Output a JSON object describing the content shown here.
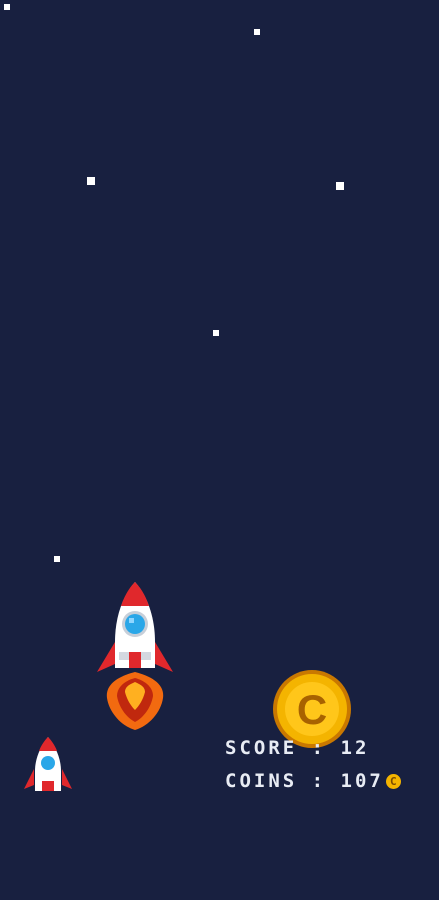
{
  "hud": {
    "score_label": "SCORE : 12",
    "coins_label": "COINS : 107",
    "coin_icon_glyph": "C"
  },
  "coin": {
    "glyph": "C"
  },
  "colors": {
    "background": "#182040",
    "star": "#ffffff",
    "coin": "#f4b400",
    "rocket_body": "#ffffff",
    "rocket_accent": "#e0282c",
    "rocket_window": "#2aa7e8",
    "flame": "#f26a10"
  },
  "icons": {
    "player_rocket": "rocket-icon",
    "life_rocket": "rocket-icon",
    "pickup_coin": "coin-icon"
  }
}
